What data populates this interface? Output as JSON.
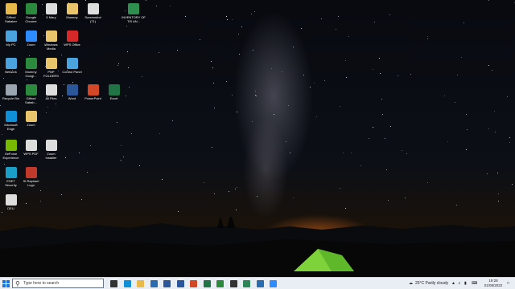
{
  "desktop_icons": [
    {
      "label": "Gifford Sabaker",
      "icon": "person-icon",
      "color": "#e8b84a"
    },
    {
      "label": "Google Chrome",
      "icon": "chrome-icon",
      "color": "#2b8a3e"
    },
    {
      "label": "5 Mary",
      "icon": "file-icon",
      "color": "#dddddd"
    },
    {
      "label": "Mommy",
      "icon": "folder-icon",
      "color": "#e9c46a"
    },
    {
      "label": "Screenshot (71)",
      "icon": "image-icon",
      "color": "#dddddd"
    },
    {
      "label": "INVENTORY OF TIS AN...",
      "icon": "spreadsheet-icon",
      "color": "#2f8f4e"
    },
    {
      "label": "My PC",
      "icon": "computer-icon",
      "color": "#4aa3df"
    },
    {
      "label": "Zoom",
      "icon": "zoom-icon",
      "color": "#2d8cff"
    },
    {
      "label": "Windows Media",
      "icon": "media-icon",
      "color": "#e9c46a"
    },
    {
      "label": "WPS Office",
      "icon": "wps-icon",
      "color": "#d62828"
    },
    {
      "label": "Network",
      "icon": "network-icon",
      "color": "#4aa3df"
    },
    {
      "label": "Mommy Googl...",
      "icon": "chrome-icon",
      "color": "#2b8a3e"
    },
    {
      "label": "PNP FOLDERS",
      "icon": "folder-icon",
      "color": "#e9c46a"
    },
    {
      "label": "Control Panel",
      "icon": "control-panel-icon",
      "color": "#4aa3df"
    },
    {
      "label": "Recycle Bin",
      "icon": "recycle-bin-icon",
      "color": "#9aa5b1"
    },
    {
      "label": "Gifford Sabab...",
      "icon": "chrome-icon",
      "color": "#2b8a3e"
    },
    {
      "label": "All Files",
      "icon": "file-icon",
      "color": "#dddddd"
    },
    {
      "label": "Word",
      "icon": "word-icon",
      "color": "#2b579a"
    },
    {
      "label": "PowerPoint",
      "icon": "powerpoint-icon",
      "color": "#d24726"
    },
    {
      "label": "Excel",
      "icon": "excel-icon",
      "color": "#217346"
    },
    {
      "label": "Microsoft Edge",
      "icon": "edge-icon",
      "color": "#0f8fd8"
    },
    {
      "label": "Zoom",
      "icon": "folder-icon",
      "color": "#e9c46a"
    },
    {
      "label": "GeForce Experience",
      "icon": "nvidia-icon",
      "color": "#76b900"
    },
    {
      "label": "WPS PDF",
      "icon": "pdf-icon",
      "color": "#dddddd"
    },
    {
      "label": "Zoom Installer",
      "icon": "installer-icon",
      "color": "#dddddd"
    },
    {
      "label": "ESET Security",
      "icon": "eset-icon",
      "color": "#1aa0c8"
    },
    {
      "label": "St Raphael Logo",
      "icon": "logo-image-icon",
      "color": "#c0392b"
    },
    {
      "label": "DEU",
      "icon": "file-icon",
      "color": "#dddddd"
    }
  ],
  "taskbar": {
    "search_placeholder": "Type here to search",
    "apps": [
      {
        "name": "task-view-icon",
        "color": "#333333"
      },
      {
        "name": "edge-icon",
        "color": "#0f8fd8"
      },
      {
        "name": "file-explorer-icon",
        "color": "#e9b949"
      },
      {
        "name": "store-icon",
        "color": "#2b6cb0"
      },
      {
        "name": "mail-icon",
        "color": "#2b579a"
      },
      {
        "name": "word-icon",
        "color": "#2b579a"
      },
      {
        "name": "powerpoint-icon",
        "color": "#d24726"
      },
      {
        "name": "excel-icon",
        "color": "#217346"
      },
      {
        "name": "chrome-icon",
        "color": "#2b8a3e"
      },
      {
        "name": "media-icon",
        "color": "#333333"
      },
      {
        "name": "shield-icon",
        "color": "#2f855a"
      },
      {
        "name": "photos-icon",
        "color": "#2b6cb0"
      },
      {
        "name": "zoom-icon",
        "color": "#2d8cff"
      }
    ],
    "weather": "25°C  Partly cloudy",
    "time": "19:28",
    "date": "01/08/2022"
  }
}
